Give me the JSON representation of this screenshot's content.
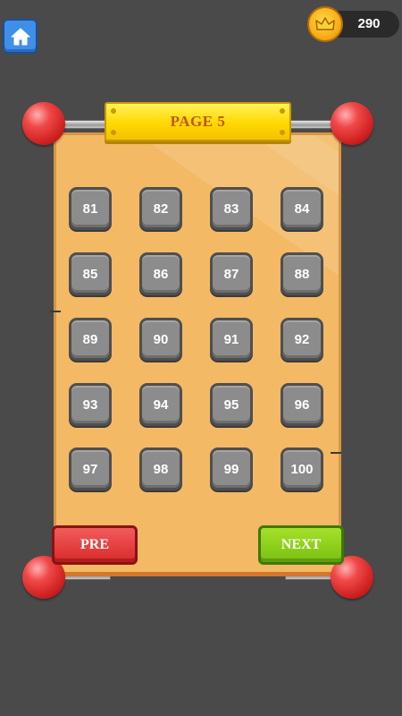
{
  "header": {
    "home_icon": "home-icon",
    "coin_icon": "crown-coin-icon",
    "coins": "290"
  },
  "board": {
    "title": "PAGE 5",
    "levels": [
      "81",
      "82",
      "83",
      "84",
      "85",
      "86",
      "87",
      "88",
      "89",
      "90",
      "91",
      "92",
      "93",
      "94",
      "95",
      "96",
      "97",
      "98",
      "99",
      "100"
    ]
  },
  "nav": {
    "pre_label": "PRE",
    "next_label": "NEXT"
  },
  "colors": {
    "background": "#4a4a4a",
    "board": "#f3b964",
    "title_plate": "#ffd800",
    "level_tile": "#8c8c8c",
    "pre_button": "#d92a2a",
    "next_button": "#79c012",
    "knob": "#e03030",
    "home_button": "#3f8fe8"
  }
}
